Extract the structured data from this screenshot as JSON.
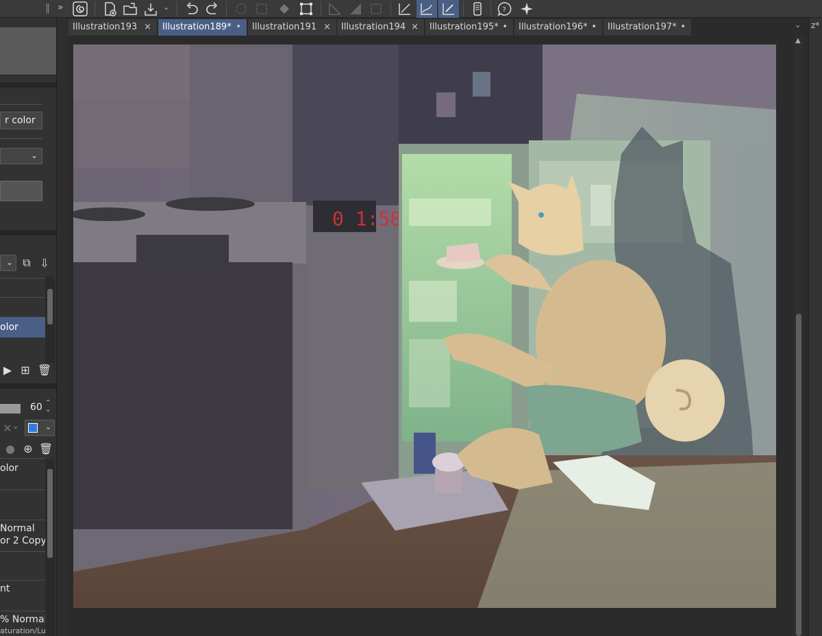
{
  "tabs": [
    {
      "label": "Illustration193",
      "mark": "×",
      "active": false
    },
    {
      "label": "Illustration189*",
      "mark": "•",
      "active": true
    },
    {
      "label": "Illustration191",
      "mark": "×",
      "active": false
    },
    {
      "label": "Illustration194",
      "mark": "×",
      "active": false
    },
    {
      "label": "Illustration195*",
      "mark": "•",
      "active": false
    },
    {
      "label": "Illustration196*",
      "mark": "•",
      "active": false
    },
    {
      "label": "Illustration197*",
      "mark": "•",
      "active": false
    }
  ],
  "tabs_overflow": "⌄",
  "right_panel_label": "z*",
  "left_panel": {
    "color_button_label": "r color",
    "layer_selected_label": "olor",
    "opacity_value": "60",
    "layer_color_label": "olor",
    "blend_mode_1": "Normal",
    "layer_name_copy": "or 2 Copy",
    "layer_partial": "nt",
    "blend_mode_2": "% Normal",
    "layer_name_sat": "aturation/Lu"
  },
  "clock_display": "0 1:58",
  "toolbar_icons": [
    "spiral-logo-icon",
    "new-canvas-icon",
    "open-folder-icon",
    "export-icon",
    "undo-icon",
    "redo-icon",
    "select-lasso-icon",
    "select-rect-icon",
    "fill-icon",
    "transform-icon",
    "ruler-icon",
    "gradient-icon",
    "clear-icon",
    "line-tool-icon",
    "curve-tool-icon",
    "pen-tool-icon",
    "phone-icon",
    "help-icon",
    "sparkle-icon"
  ]
}
